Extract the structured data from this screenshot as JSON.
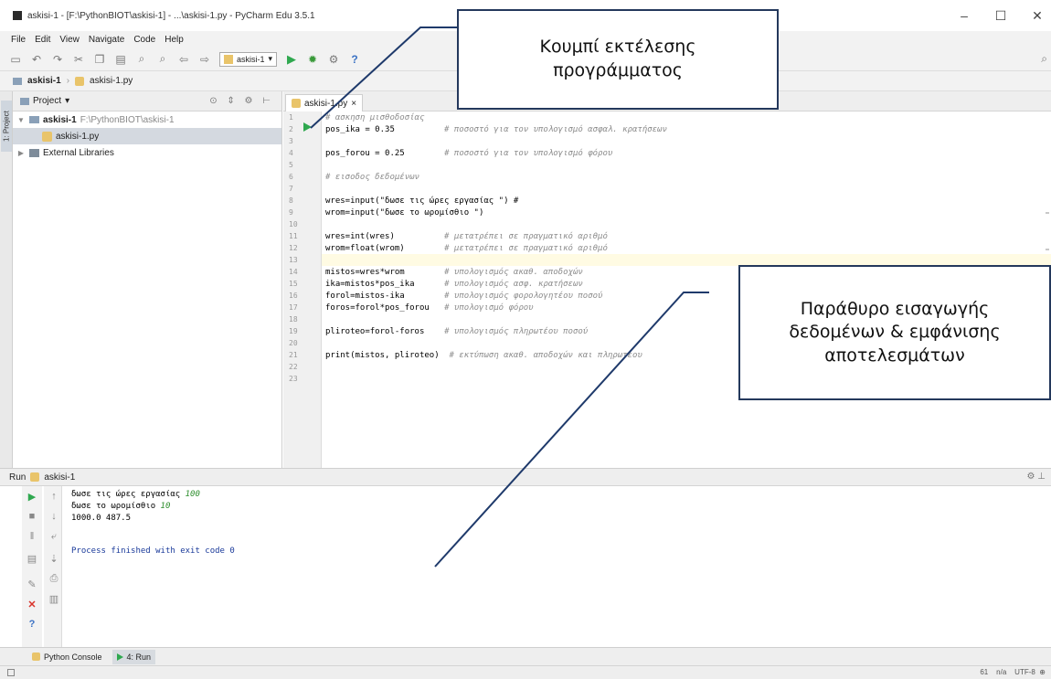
{
  "window": {
    "title": "askisi-1 - [F:\\PythonBIOT\\askisi-1] - ...\\askisi-1.py - PyCharm Edu 3.5.1",
    "controls": [
      "–",
      "☐",
      "✕"
    ]
  },
  "menu": [
    "File",
    "Edit",
    "View",
    "Navigate",
    "Code",
    "Help"
  ],
  "toolbar": {
    "run_config": "askisi-1",
    "help": "?"
  },
  "breadcrumb": {
    "project": "askisi-1",
    "file": "askisi-1.py"
  },
  "sidebar": {
    "project_tab": "1: Project"
  },
  "project_panel": {
    "header": "Project",
    "tree": [
      {
        "label": "askisi-1",
        "path": "F:\\PythonBIOT\\askisi-1"
      },
      {
        "label": "askisi-1.py",
        "path": ""
      },
      {
        "label": "External Libraries",
        "path": ""
      }
    ]
  },
  "editor": {
    "tab": "askisi-1.py",
    "lines": [
      {
        "no": "1",
        "code": "# ασκηση μισθοδοσίας",
        "comment": ""
      },
      {
        "no": "2",
        "code": "pos_ika = 0.35",
        "comment": "# ποσοστό για τον υπολογισμό ασφαλ. κρατήσεων"
      },
      {
        "no": "3",
        "code": "",
        "comment": ""
      },
      {
        "no": "4",
        "code": "pos_forou = 0.25",
        "comment": "# ποσοστό για τον υπολογισμό φόρου"
      },
      {
        "no": "5",
        "code": "",
        "comment": ""
      },
      {
        "no": "6",
        "code": "# εισοδος δεδομένων",
        "comment": ""
      },
      {
        "no": "7",
        "code": "",
        "comment": ""
      },
      {
        "no": "8",
        "code": "wres=input(\"δωσε τις ώρες εργασίας \") #",
        "comment": ""
      },
      {
        "no": "9",
        "code": "wrom=input(\"δωσε το ωρομίσθιο \")",
        "comment": ""
      },
      {
        "no": "10",
        "code": "",
        "comment": ""
      },
      {
        "no": "11",
        "code": "wres=int(wres)",
        "comment": "# μετατρέπει σε πραγματικό αριθμό"
      },
      {
        "no": "12",
        "code": "wrom=float(wrom)",
        "comment": "# μετατρέπει σε πραγματικό αριθμό"
      },
      {
        "no": "13",
        "code": "",
        "comment": ""
      },
      {
        "no": "14",
        "code": "mistos=wres*wrom",
        "comment": "# υπολογισμός ακαθ. αποδοχών"
      },
      {
        "no": "15",
        "code": "ika=mistos*pos_ika",
        "comment": "# υπολογισμός ασφ. κρατήσεων"
      },
      {
        "no": "16",
        "code": "forol=mistos-ika",
        "comment": "# υπολογισμός φορολογητέου ποσού"
      },
      {
        "no": "17",
        "code": "foros=forol*pos_forou",
        "comment": "# υπολογισμό φόρου"
      },
      {
        "no": "18",
        "code": "",
        "comment": ""
      },
      {
        "no": "19",
        "code": "pliroteo=forol-foros",
        "comment": "# υπολογισμός πληρωτέου ποσού"
      },
      {
        "no": "20",
        "code": "",
        "comment": ""
      },
      {
        "no": "21",
        "code": "print(mistos, pliroteo)",
        "comment": "# εκτύπωση ακαθ. αποδοχών και πληρωτέου"
      },
      {
        "no": "22",
        "code": "",
        "comment": ""
      },
      {
        "no": "23",
        "code": "",
        "comment": ""
      }
    ]
  },
  "run_panel": {
    "title": "Run",
    "config": "askisi-1",
    "output": [
      {
        "prompt": "δωσε τις ώρες εργασίας ",
        "input": "100"
      },
      {
        "prompt": "δωσε το ωρομίσθιο ",
        "input": "10"
      },
      {
        "prompt": "1000.0 487.5",
        "input": ""
      },
      {
        "prompt": "",
        "input": ""
      },
      {
        "prompt": "Process finished with exit code 0",
        "input": ""
      }
    ]
  },
  "bottom_tabs": {
    "console": "Python Console",
    "run": "4: Run"
  },
  "status": {
    "position": "61",
    "line_sep": "n/a",
    "encoding": "UTF-8"
  },
  "callouts": {
    "run_button": [
      "Κουμπί εκτέλεσης",
      "προγράμματος"
    ],
    "io_window": [
      "Παράθυρο εισαγωγής",
      "δεδομένων & εμφάνισης",
      "αποτελεσμάτων"
    ]
  },
  "colors": {
    "run_green": "#2fa84f",
    "callout_border": "#24385c",
    "leader_line": "#1f3a6b"
  }
}
